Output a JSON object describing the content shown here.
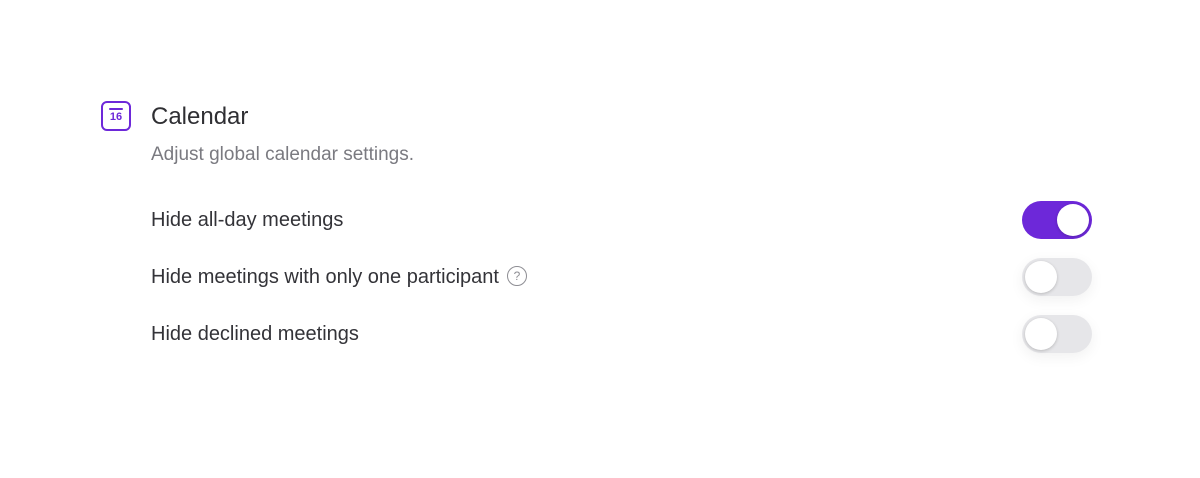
{
  "section": {
    "icon": "calendar-icon",
    "icon_day": "16",
    "title": "Calendar",
    "subtitle": "Adjust global calendar settings.",
    "accent_color": "#6d28d9"
  },
  "settings": [
    {
      "label": "Hide all-day meetings",
      "enabled": true,
      "help": false
    },
    {
      "label": "Hide meetings with only one participant",
      "enabled": false,
      "help": true,
      "help_icon": "question-circle-icon",
      "help_glyph": "?"
    },
    {
      "label": "Hide declined meetings",
      "enabled": false,
      "help": false
    }
  ]
}
